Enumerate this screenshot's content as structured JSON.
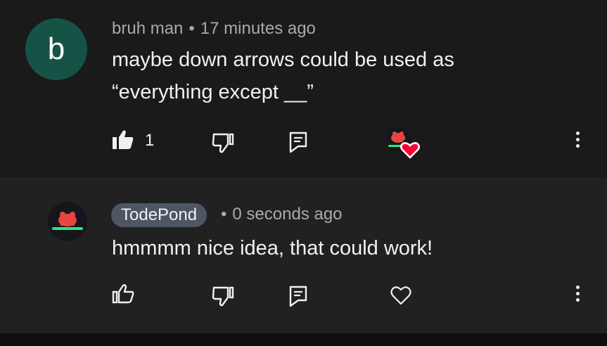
{
  "comments": [
    {
      "avatar_letter": "b",
      "author": "bruh man",
      "separator": "•",
      "time": "17 minutes ago",
      "text_line1": "maybe down arrows could be used as",
      "text_line2": "“everything except __”",
      "like_count": "1",
      "liked": true,
      "creator_hearted": true
    },
    {
      "author": "TodePond",
      "separator": "•",
      "time": "0 seconds ago",
      "text_line1": "hmmmm nice idea, that could work!",
      "liked": false
    }
  ],
  "colors": {
    "accent_green": "#2fe37a",
    "heart_red": "#ff0033",
    "frog_red": "#e8453f",
    "avatar_b_bg": "#155346",
    "chip_bg": "#4e5663"
  },
  "icons": [
    "thumbs-up-filled-icon",
    "thumbs-down-icon",
    "reply-icon",
    "creator-heart-icon",
    "more-vert-icon",
    "thumbs-up-icon",
    "heart-outline-icon"
  ]
}
